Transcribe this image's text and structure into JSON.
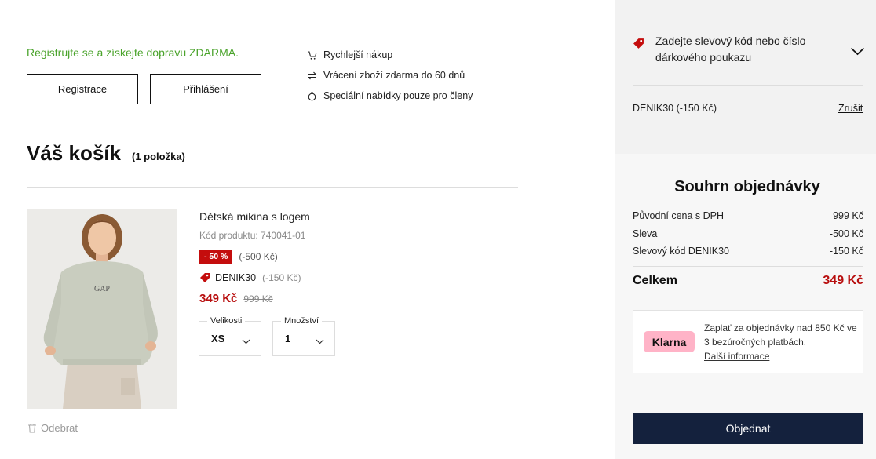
{
  "promo": {
    "text": "Registrujte se a získejte dopravu ZDARMA.",
    "register_label": "Registrace",
    "login_label": "Přihlášení"
  },
  "benefits": [
    {
      "icon": "cart-icon",
      "label": "Rychlejší nákup"
    },
    {
      "icon": "exchange-arrows-icon",
      "label": "Vrácení zboží zdarma do 60 dnů"
    },
    {
      "icon": "offer-hand-icon",
      "label": "Speciální nabídky pouze pro členy"
    }
  ],
  "cart": {
    "title": "Váš košík",
    "count": "(1 položka)"
  },
  "product": {
    "name": "Dětská mikina s logem",
    "code": "Kód produktu: 740041-01",
    "discount_badge": "- 50 %",
    "discount_amount": "(-500 Kč)",
    "coupon_code": "DENIK30",
    "coupon_amount": "(-150 Kč)",
    "price": "349 Kč",
    "old_price": "999 Kč",
    "size_label": "Velikosti",
    "size_value": "XS",
    "qty_label": "Množství",
    "qty_value": "1",
    "remove_label": "Odebrat",
    "logo_text": "GAP"
  },
  "sidebar": {
    "coupon_prompt": "Zadejte slevový kód nebo číslo dárkového poukazu",
    "applied_coupon": "DENIK30 (-150 Kč)",
    "cancel_label": "Zrušit",
    "summary_title": "Souhrn objednávky",
    "rows": [
      {
        "label": "Původní cena s DPH",
        "value": "999 Kč"
      },
      {
        "label": "Sleva",
        "value": "-500 Kč"
      },
      {
        "label": "Slevový kód DENIK30",
        "value": "-150 Kč"
      }
    ],
    "total_label": "Celkem",
    "total_value": "349 Kč",
    "klarna": {
      "logo": "Klarna",
      "text": "Zaplať za objednávky nad 850 Kč ve 3 bezúročných platbách.",
      "link": "Další informace"
    },
    "order_label": "Objednat"
  },
  "colors": {
    "promo_green": "#4aa32b",
    "price_red": "#b80f0f",
    "badge_red": "#c40d0d",
    "order_navy": "#14213d",
    "klarna_pink": "#ffb3c7"
  }
}
